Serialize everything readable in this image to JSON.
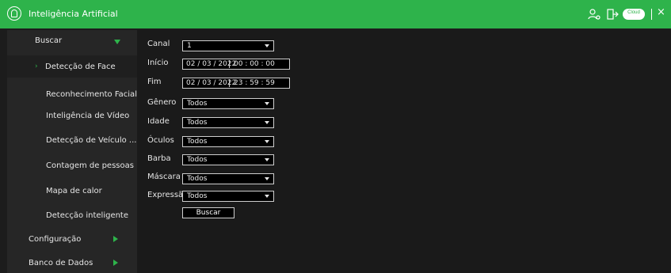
{
  "window": {
    "title": "Inteligência Artificial",
    "cloud_label": "Cloud",
    "close_glyph": "×"
  },
  "sidebar": {
    "items": [
      {
        "label": "Buscar",
        "icon": "triangle-down-icon"
      },
      {
        "label": "Detecção de Face",
        "icon": "chevron-right-icon"
      },
      {
        "label": "Reconhecimento Facial"
      },
      {
        "label": "Inteligência de Vídeo"
      },
      {
        "label": "Detecção de Veículo ..."
      },
      {
        "label": "Contagem de pessoas"
      },
      {
        "label": "Mapa de calor"
      },
      {
        "label": "Detecção inteligente"
      },
      {
        "label": "Configuração",
        "icon": "triangle-right-icon"
      },
      {
        "label": "Banco de Dados",
        "icon": "triangle-right-icon"
      }
    ]
  },
  "form": {
    "canal": {
      "label": "Canal",
      "value": "1"
    },
    "inicio": {
      "label": "Início",
      "date": "02 / 03 / 2022",
      "time": "00 : 00 : 00"
    },
    "fim": {
      "label": "Fim",
      "date": "02 / 03 / 2022",
      "time": "23 : 59 : 59"
    },
    "genero": {
      "label": "Gênero",
      "value": "Todos"
    },
    "idade": {
      "label": "Idade",
      "value": "Todos"
    },
    "oculos": {
      "label": "Óculos",
      "value": "Todos"
    },
    "barba": {
      "label": "Barba",
      "value": "Todos"
    },
    "mascara": {
      "label": "Máscara",
      "value": "Todos"
    },
    "expressao": {
      "label": "Expressão",
      "value": "Todos"
    },
    "buscar_button": "Buscar"
  },
  "colors": {
    "accent": "#2eb34b",
    "background": "#1a1a1a",
    "sidebar": "#262626"
  }
}
